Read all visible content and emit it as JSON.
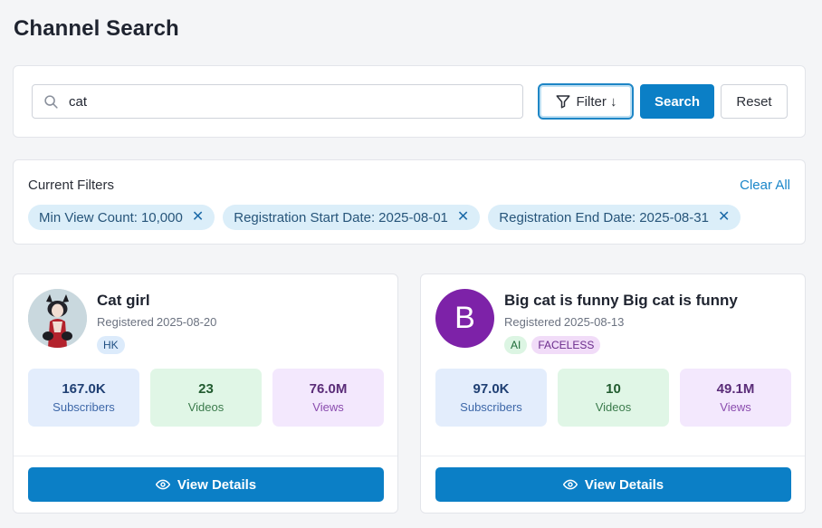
{
  "page": {
    "title": "Channel Search"
  },
  "search": {
    "value": "cat",
    "filter_label": "Filter ↓",
    "search_label": "Search",
    "reset_label": "Reset"
  },
  "filters": {
    "label": "Current Filters",
    "clear_all": "Clear All",
    "chips": [
      {
        "name": "Min View Count:",
        "value": "10,000"
      },
      {
        "name": "Registration Start Date:",
        "value": "2025-08-01"
      },
      {
        "name": "Registration End Date:",
        "value": "2025-08-31"
      }
    ]
  },
  "channels": [
    {
      "name": "Cat girl",
      "registered_label": "Registered",
      "registered_date": "2025-08-20",
      "avatar": {
        "type": "photo"
      },
      "tags": [
        "HK"
      ],
      "stats": [
        {
          "value": "167.0K",
          "label": "Subscribers"
        },
        {
          "value": "23",
          "label": "Videos"
        },
        {
          "value": "76.0M",
          "label": "Views"
        }
      ],
      "action_label": "View Details"
    },
    {
      "name": "Big cat is funny Big cat is funny",
      "registered_label": "Registered",
      "registered_date": "2025-08-13",
      "avatar": {
        "type": "letter",
        "letter": "B",
        "color": "#7d22a8"
      },
      "tags": [
        "AI",
        "FACELESS"
      ],
      "stats": [
        {
          "value": "97.0K",
          "label": "Subscribers"
        },
        {
          "value": "10",
          "label": "Videos"
        },
        {
          "value": "49.1M",
          "label": "Views"
        }
      ],
      "action_label": "View Details"
    }
  ],
  "icons": {
    "search": "search-icon",
    "filter": "filter-icon",
    "close": "close-icon",
    "eye": "eye-icon"
  },
  "colors": {
    "primary": "#0b7fc6",
    "link": "#1a86c9",
    "chip_bg": "#dbeef9"
  }
}
